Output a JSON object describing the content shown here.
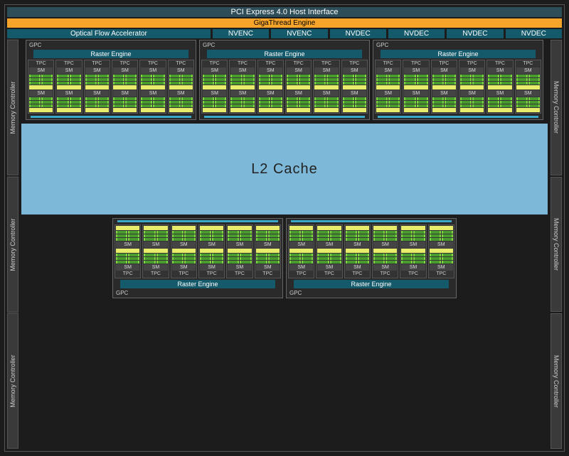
{
  "top": {
    "pci": "PCI Express 4.0 Host Interface",
    "giga": "GigaThread Engine",
    "ofa": "Optical Flow Accelerator",
    "encoders": [
      "NVENC",
      "NVENC",
      "NVDEC",
      "NVDEC",
      "NVDEC",
      "NVDEC"
    ]
  },
  "labels": {
    "gpc": "GPC",
    "raster": "Raster Engine",
    "tpc": "TPC",
    "sm": "SM",
    "memctrl": "Memory Controller",
    "l2": "L2 Cache"
  },
  "layout": {
    "top_gpc_count": 3,
    "bottom_gpc_count": 2,
    "tpc_per_gpc": 6,
    "sm_per_tpc": 2,
    "mem_controllers_per_side": 3
  }
}
